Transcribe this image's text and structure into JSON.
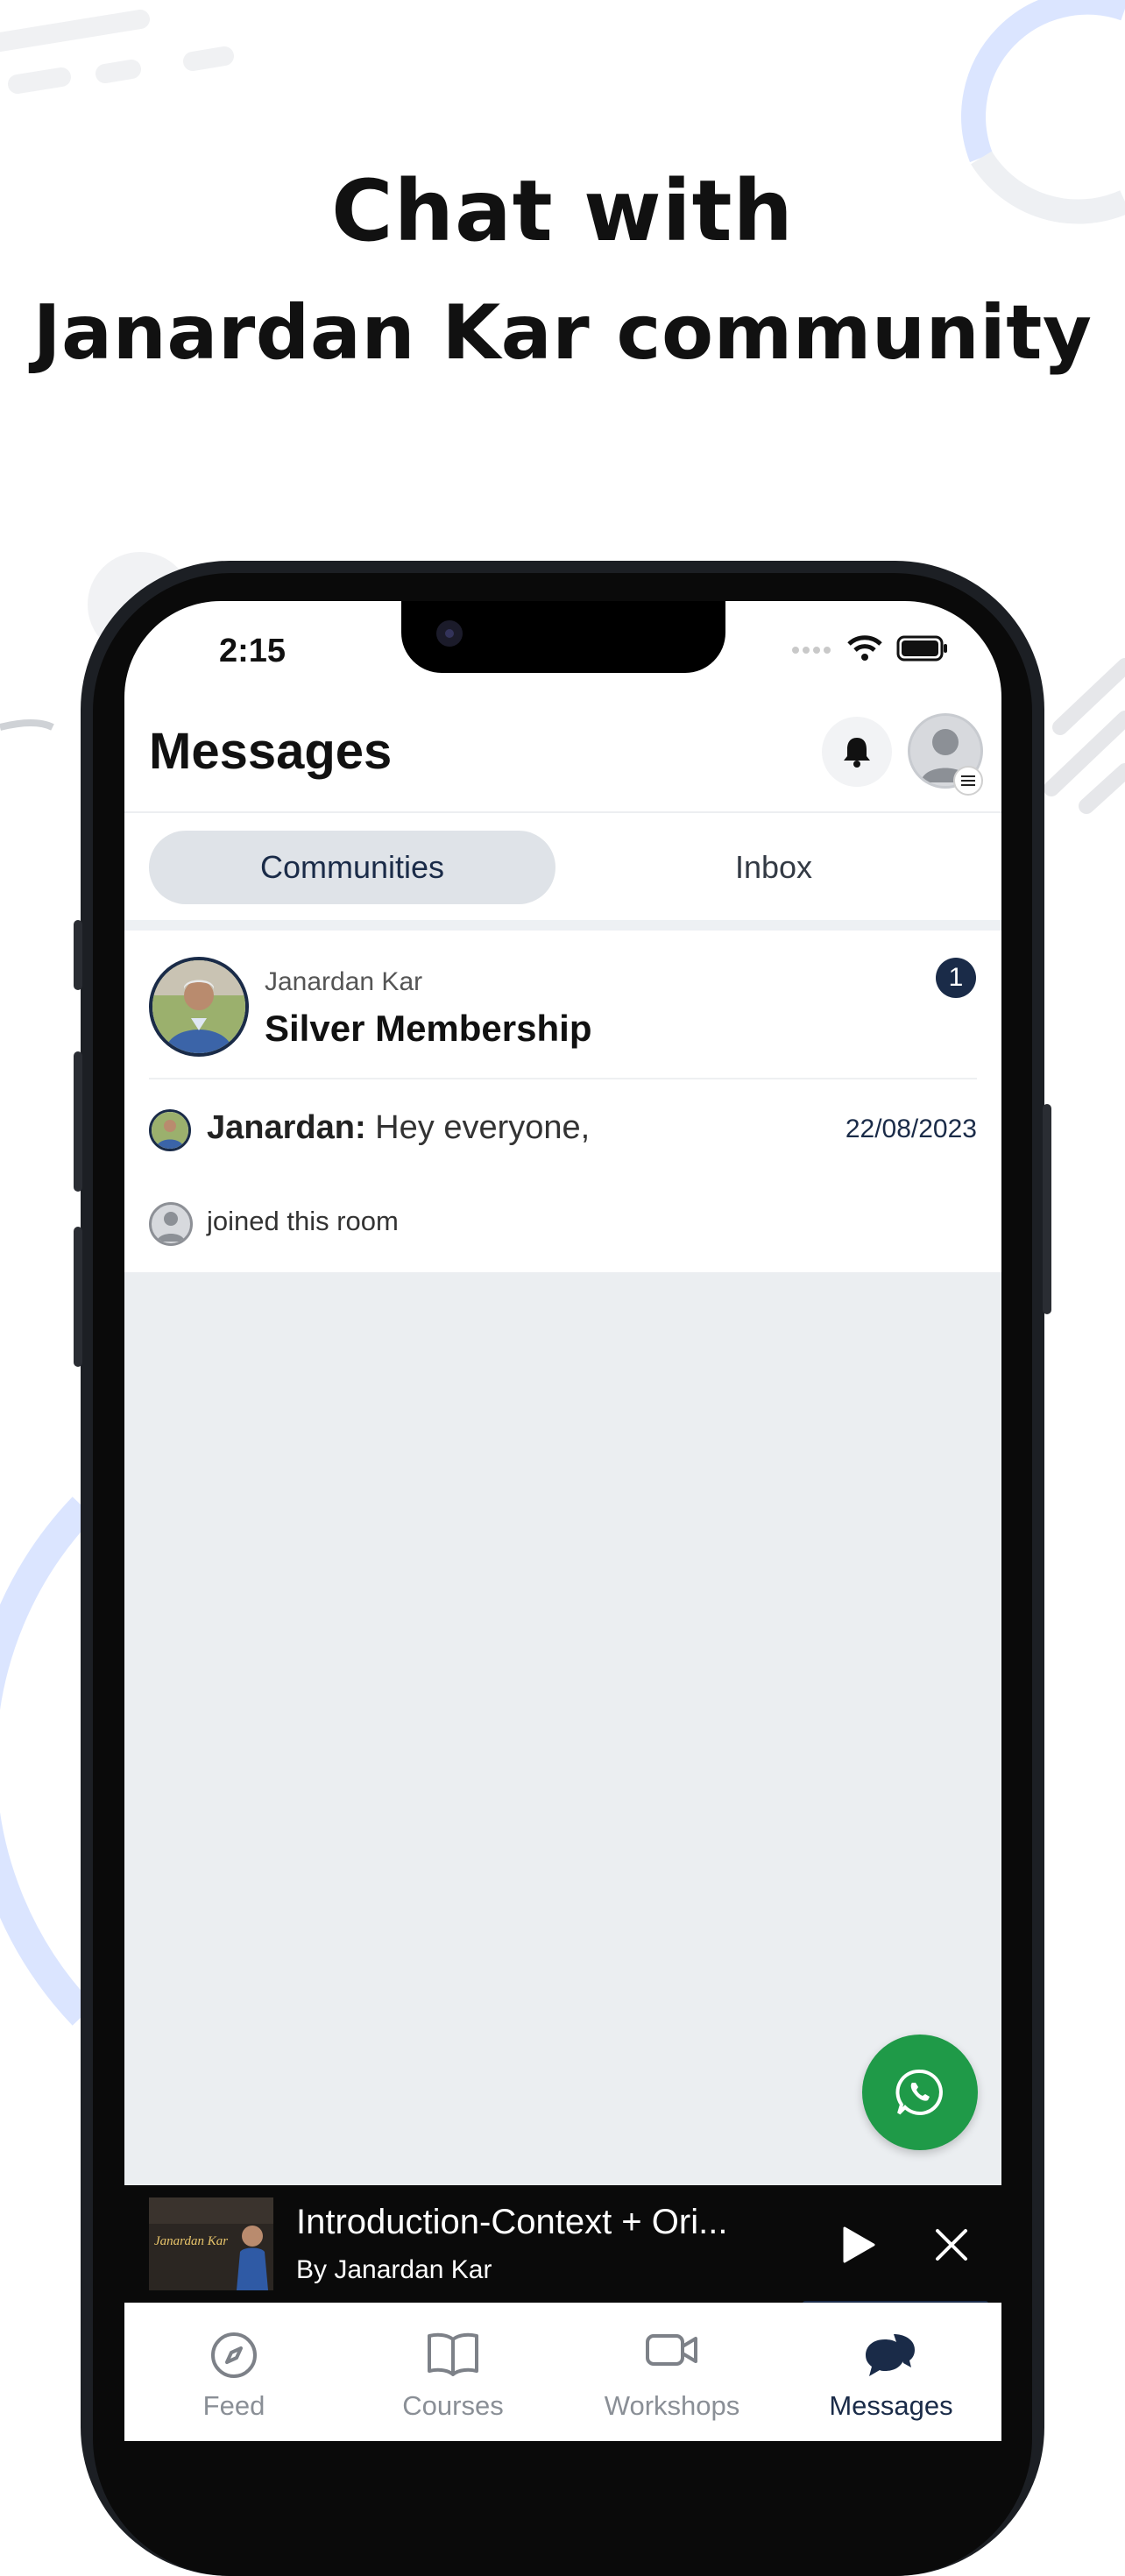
{
  "headline": {
    "line1": "Chat with",
    "line2": "Janardan Kar community"
  },
  "status_bar": {
    "time": "2:15"
  },
  "header": {
    "title": "Messages"
  },
  "tabs": [
    {
      "label": "Communities",
      "active": true
    },
    {
      "label": "Inbox",
      "active": false
    }
  ],
  "community": {
    "owner": "Janardan Kar",
    "name": "Silver Membership",
    "unread_count": "1",
    "last_message": {
      "sender": "Janardan:",
      "text": " Hey everyone,",
      "date": "22/08/2023"
    },
    "activity": "joined this room"
  },
  "player": {
    "title": "Introduction-Context + Ori...",
    "byline_prefix": "By",
    "byline_author": "Janardan Kar",
    "thumbnail_text": "Janardan Kar"
  },
  "bottom_nav": [
    {
      "label": "Feed",
      "icon": "compass-icon",
      "active": false
    },
    {
      "label": "Courses",
      "icon": "book-icon",
      "active": false
    },
    {
      "label": "Workshops",
      "icon": "video-camera-icon",
      "active": false
    },
    {
      "label": "Messages",
      "icon": "chat-bubbles-icon",
      "active": true
    }
  ],
  "colors": {
    "brand_navy": "#1a2b48",
    "whatsapp_green": "#1f9a48",
    "tab_active_bg": "#dfe3e8",
    "empty_bg": "#ebeef1",
    "decor_blue": "#dbe5ff"
  }
}
